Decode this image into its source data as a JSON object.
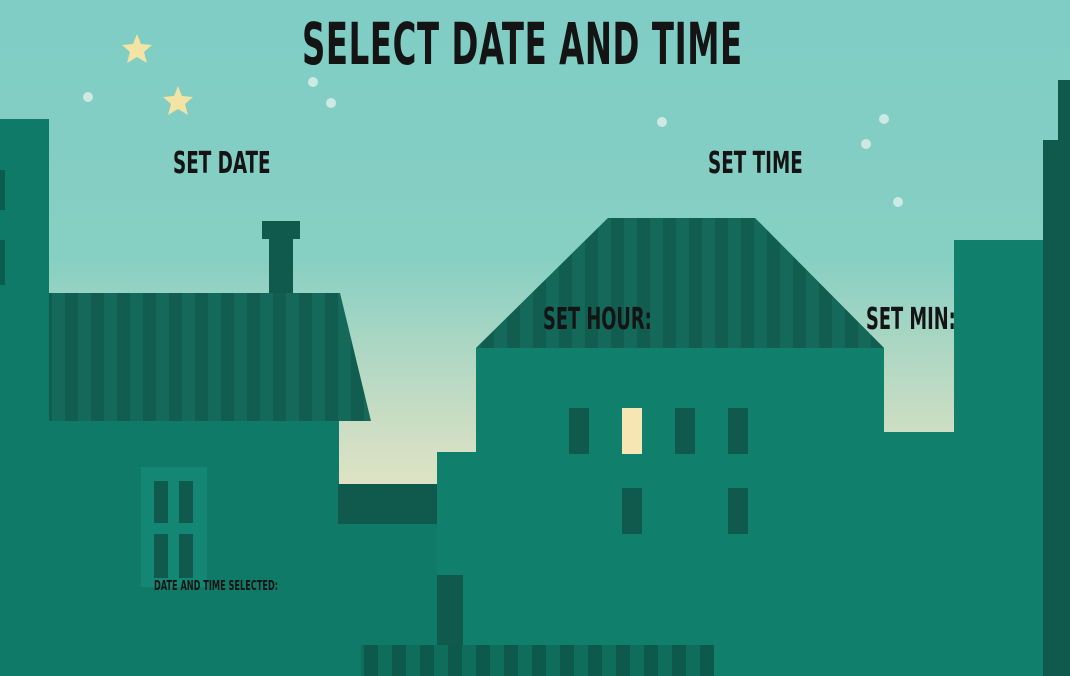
{
  "header": {
    "title": "SELECT DATE AND TIME"
  },
  "date_section": {
    "label": "SET DATE"
  },
  "time_section": {
    "label": "SET TIME",
    "hour_label": "SET HOUR:",
    "minute_label": "SET MIN:"
  },
  "result": {
    "label": "DATE AND TIME SELECTED:"
  },
  "background": {
    "sky_top": "#7ecdc5",
    "sky_bottom": "#f3e9c4",
    "building_main": "#0f7a67",
    "building_dark": "#0f5a4c",
    "roof_stripe": "#13695a",
    "lit_window": "#f6e6b4",
    "star": "#f4e6a8"
  }
}
